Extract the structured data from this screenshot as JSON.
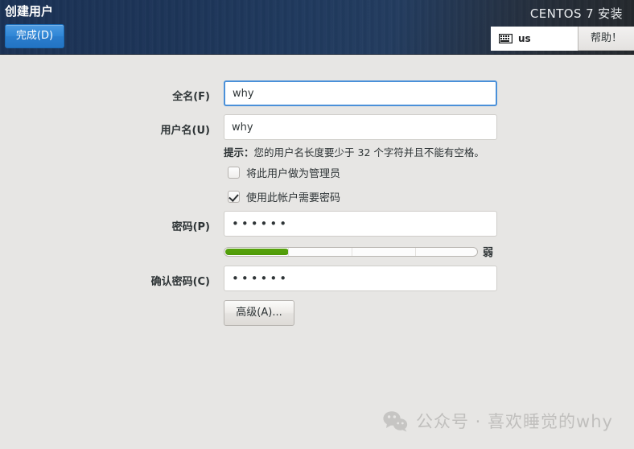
{
  "header": {
    "page_title": "创建用户",
    "done_button": "完成(D)",
    "product_title": "CENTOS 7 安装",
    "keyboard_layout": "us",
    "keyboard_icon": "keyboard-icon",
    "help_button": "帮助！"
  },
  "form": {
    "fullname": {
      "label": "全名(F)",
      "value": "why",
      "placeholder": ""
    },
    "username": {
      "label": "用户名(U)",
      "value": "why",
      "placeholder": ""
    },
    "hint": {
      "prefix": "提示：",
      "text": "您的用户名长度要少于 32 个字符并且不能有空格。"
    },
    "checkboxes": [
      {
        "label": "将此用户做为管理员",
        "checked": false
      },
      {
        "label": "使用此帐户需要密码",
        "checked": true
      }
    ],
    "password": {
      "label": "密码(P)",
      "value": "••••••",
      "placeholder": ""
    },
    "strength": {
      "label": "弱",
      "percent": 25,
      "segments": 4,
      "fill_color": "#56a30c"
    },
    "confirm_password": {
      "label": "确认密码(C)",
      "value": "••••••",
      "placeholder": ""
    },
    "advanced_button": "高级(A)..."
  },
  "watermark": {
    "icon": "wechat-icon",
    "text": "公众号 · 喜欢睡觉的why"
  },
  "colors": {
    "accent_blue": "#2f86d6",
    "focus_border": "#4a90d9",
    "header_navy": "#1d3558",
    "body_bg": "#e7e6e4",
    "strength_green": "#56a30c",
    "watermark_gray": "#c0bfbd"
  }
}
